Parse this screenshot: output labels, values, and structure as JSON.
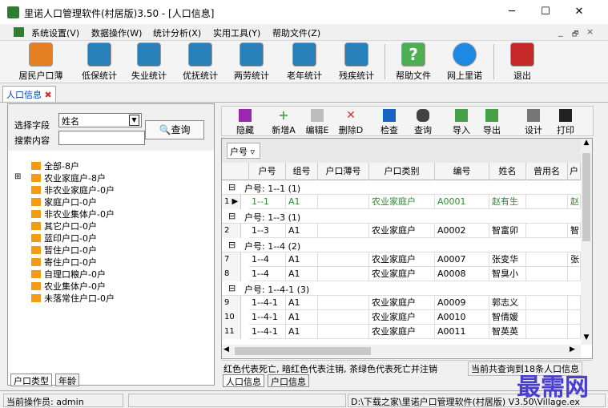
{
  "window": {
    "title": "里诺人口管理软件(村居版)3.50 - [人口信息]",
    "minimize": "─",
    "maximize": "☐",
    "close": "✕"
  },
  "menu": {
    "items": [
      "系统设置(V)",
      "数据操作(W)",
      "统计分析(X)",
      "实用工具(Y)",
      "帮助文件(Z)"
    ],
    "child_controls": [
      "_",
      "🗗",
      "×"
    ]
  },
  "toolbar": {
    "items": [
      "居民户口薄",
      "低保统计",
      "失业统计",
      "优抚统计",
      "两劳统计",
      "老年统计",
      "残疾统计",
      "帮助文件",
      "网上里诺",
      "退出"
    ]
  },
  "doc_tab": {
    "label": "人口信息",
    "close": "✖"
  },
  "search": {
    "field_label": "选择字段",
    "field_value": "姓名",
    "content_label": "搜索内容",
    "content_value": "",
    "query_button": "查询"
  },
  "tree": {
    "items": [
      "全部-8户",
      "农业家庭户-8户",
      "非农业家庭户-0户",
      "家庭户口-0户",
      "非农业集体户-0户",
      "其它户口-0户",
      "蓝印户口-0户",
      "暂住户口-0户",
      "寄住户口-0户",
      "自理口粮户-0户",
      "农业集体户-0户",
      "未落常住户口-0户"
    ],
    "expander": "⊞"
  },
  "left_tabs": [
    "户口类型",
    "年龄"
  ],
  "record_toolbar": {
    "items": [
      "隐藏",
      "新增A",
      "编辑E",
      "删除D",
      "检查",
      "查询",
      "导入",
      "导出",
      "设计",
      "打印"
    ]
  },
  "grid": {
    "group_chip": "户号 ▿",
    "columns": [
      "户号",
      "组号",
      "户口薄号",
      "户口类别",
      "编号",
      "姓名",
      "曾用名",
      "户"
    ],
    "groups": [
      {
        "label": "户号: 1--1 (1)",
        "rows": [
          {
            "n": "1 ▶",
            "hh": "1--1",
            "zh": "A1",
            "hkb": "",
            "lb": "农业家庭户",
            "bh": "A0001",
            "xm": "赵有生",
            "cym": "",
            "h": "赵"
          }
        ]
      },
      {
        "label": "户号: 1--3 (1)",
        "rows": [
          {
            "n": "2",
            "hh": "1--3",
            "zh": "A1",
            "hkb": "",
            "lb": "农业家庭户",
            "bh": "A0002",
            "xm": "智富卯",
            "cym": "",
            "h": "智"
          }
        ]
      },
      {
        "label": "户号: 1--4 (2)",
        "rows": [
          {
            "n": "7",
            "hh": "1--4",
            "zh": "A1",
            "hkb": "",
            "lb": "农业家庭户",
            "bh": "A0007",
            "xm": "张变华",
            "cym": "",
            "h": "张"
          },
          {
            "n": "8",
            "hh": "1--4",
            "zh": "A1",
            "hkb": "",
            "lb": "农业家庭户",
            "bh": "A0008",
            "xm": "智臭小",
            "cym": "",
            "h": ""
          }
        ]
      },
      {
        "label": "户号: 1--4-1 (3)",
        "rows": [
          {
            "n": "9",
            "hh": "1--4-1",
            "zh": "A1",
            "hkb": "",
            "lb": "农业家庭户",
            "bh": "A0009",
            "xm": "郭志义",
            "cym": "",
            "h": ""
          },
          {
            "n": "10",
            "hh": "1--4-1",
            "zh": "A1",
            "hkb": "",
            "lb": "农业家庭户",
            "bh": "A0010",
            "xm": "智倩媛",
            "cym": "",
            "h": ""
          },
          {
            "n": "11",
            "hh": "1--4-1",
            "zh": "A1",
            "hkb": "",
            "lb": "农业家庭户",
            "bh": "A0011",
            "xm": "智英英",
            "cym": "",
            "h": ""
          }
        ]
      }
    ]
  },
  "legend": {
    "text": "红色代表死亡, 暗红色代表注销, 茶绿色代表死亡并注销",
    "count": "当前共查询到18条人口信息"
  },
  "bottom_tabs": [
    "人口信息",
    "户口信息"
  ],
  "status": {
    "operator": "当前操作员: admin",
    "path": "D:\\下载之家\\里诺户口管理软件(村居版) V3.50\\Village.ex"
  },
  "watermark": "最需网",
  "colors": {
    "selected_row_text": "#2e8b2e",
    "accent": "#0044aa"
  }
}
